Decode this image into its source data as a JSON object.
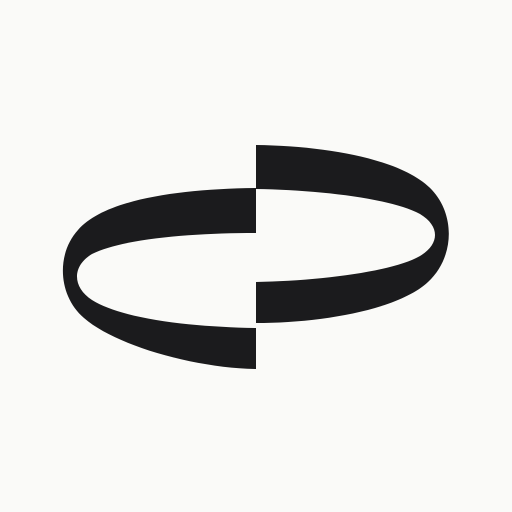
{
  "colors": {
    "background": "#fafaf8",
    "mark": "#1b1b1d"
  },
  "logo": {
    "icon": "interlocking-ribbon-logo-icon"
  }
}
